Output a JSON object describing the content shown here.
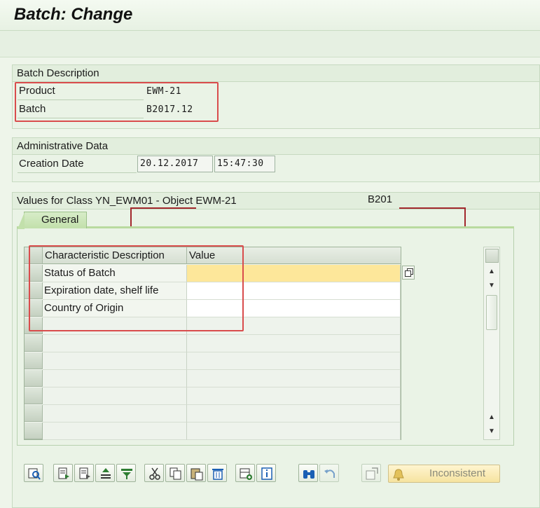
{
  "window": {
    "title": "Batch: Change"
  },
  "batch_description": {
    "heading": "Batch Description",
    "product_label": "Product",
    "product_value": "EWM-21",
    "batch_label": "Batch",
    "batch_value": "B2017.12"
  },
  "administrative": {
    "heading": "Administrative Data",
    "creation_label": "Creation Date",
    "creation_date": "20.12.2017",
    "creation_time": "15:47:30"
  },
  "values_section": {
    "heading": "Values for Class YN_EWM01 - Object EWM-21",
    "heading_suffix": "B201",
    "tab_general": "General",
    "columns": {
      "description": "Characteristic Description",
      "value": "Value"
    },
    "rows": [
      {
        "description": "Status of Batch",
        "value": "",
        "highlighted": true
      },
      {
        "description": "Expiration date, shelf life",
        "value": "",
        "highlighted": false
      },
      {
        "description": "Country of Origin",
        "value": "",
        "highlighted": false
      }
    ]
  },
  "bottom_toolbar": {
    "inconsistent_label": "Inconsistent"
  },
  "colors": {
    "background": "#eef5ea",
    "highlight_yellow": "#fde79a",
    "annotation_red": "#d94c4c",
    "tab_green": "#c2e0ab"
  },
  "icons": [
    "details-icon",
    "insert-row-icon",
    "copy-row-icon",
    "sort-ascending-icon",
    "filter-icon",
    "cut-icon",
    "copy-icon",
    "paste-icon",
    "delete-icon",
    "add-row-icon",
    "info-icon",
    "find-icon",
    "undo-icon",
    "check-icon",
    "bell-icon"
  ]
}
